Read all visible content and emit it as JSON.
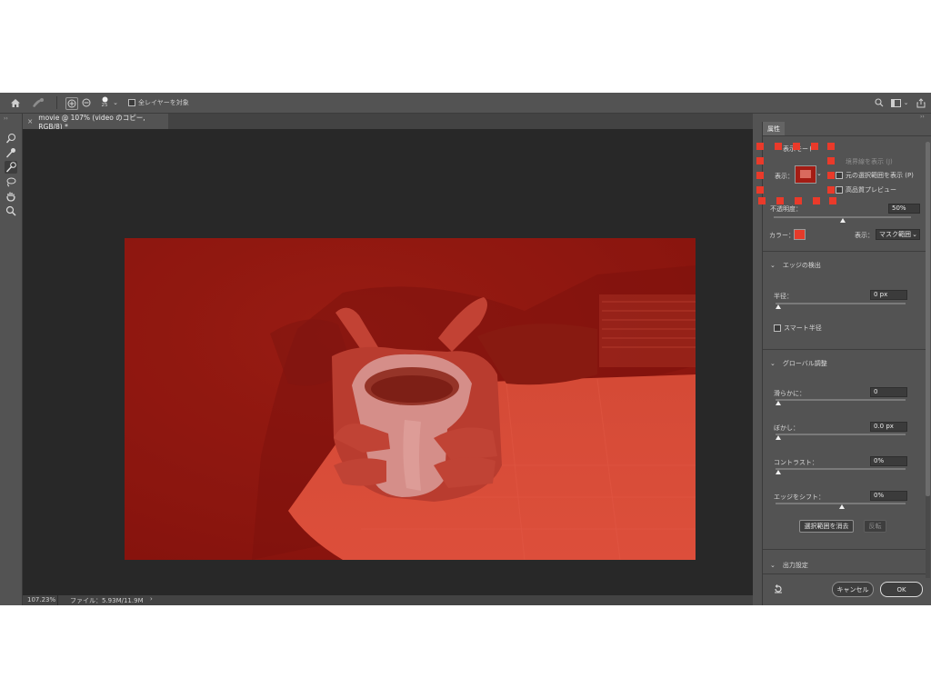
{
  "topbar": {
    "brush_size": "25",
    "sample_all_layers": "全レイヤーを対象"
  },
  "tab": {
    "close": "×",
    "title": "movie @ 107% (video のコピー, RGB/8) *"
  },
  "status": {
    "zoom": "107.23%",
    "file": "ファイル：5.93M/11.9M"
  },
  "panel": {
    "tab_label": "属性",
    "view_mode_title": "表示モード",
    "show_edges": "境界線を表示 (J)",
    "show_original": "元の選択範囲を表示 (P)",
    "high_quality": "高品質プレビュー",
    "view_label": "表示：",
    "opacity_label": "不透明度：",
    "opacity_value": "50%",
    "opacity_fraction": 0.5,
    "color_label": "カラー：",
    "color_value": "#e53b2a",
    "display_label": "表示：",
    "display_value": "マスク範囲",
    "edge_section": "エッジの検出",
    "radius_label": "半径：",
    "radius_value": "0 px",
    "smart_radius": "スマート半径",
    "global_section": "グローバル調整",
    "smooth_label": "滑らかに：",
    "smooth_value": "0",
    "feather_label": "ぼかし：",
    "feather_value": "0.0 px",
    "contrast_label": "コントラスト：",
    "contrast_value": "0%",
    "shift_label": "エッジをシフト：",
    "shift_value": "0%",
    "clear_button": "選択範囲を消去",
    "invert_button": "反転",
    "output_section": "出力設定",
    "cancel_button": "キャンセル",
    "ok_button": "OK"
  }
}
